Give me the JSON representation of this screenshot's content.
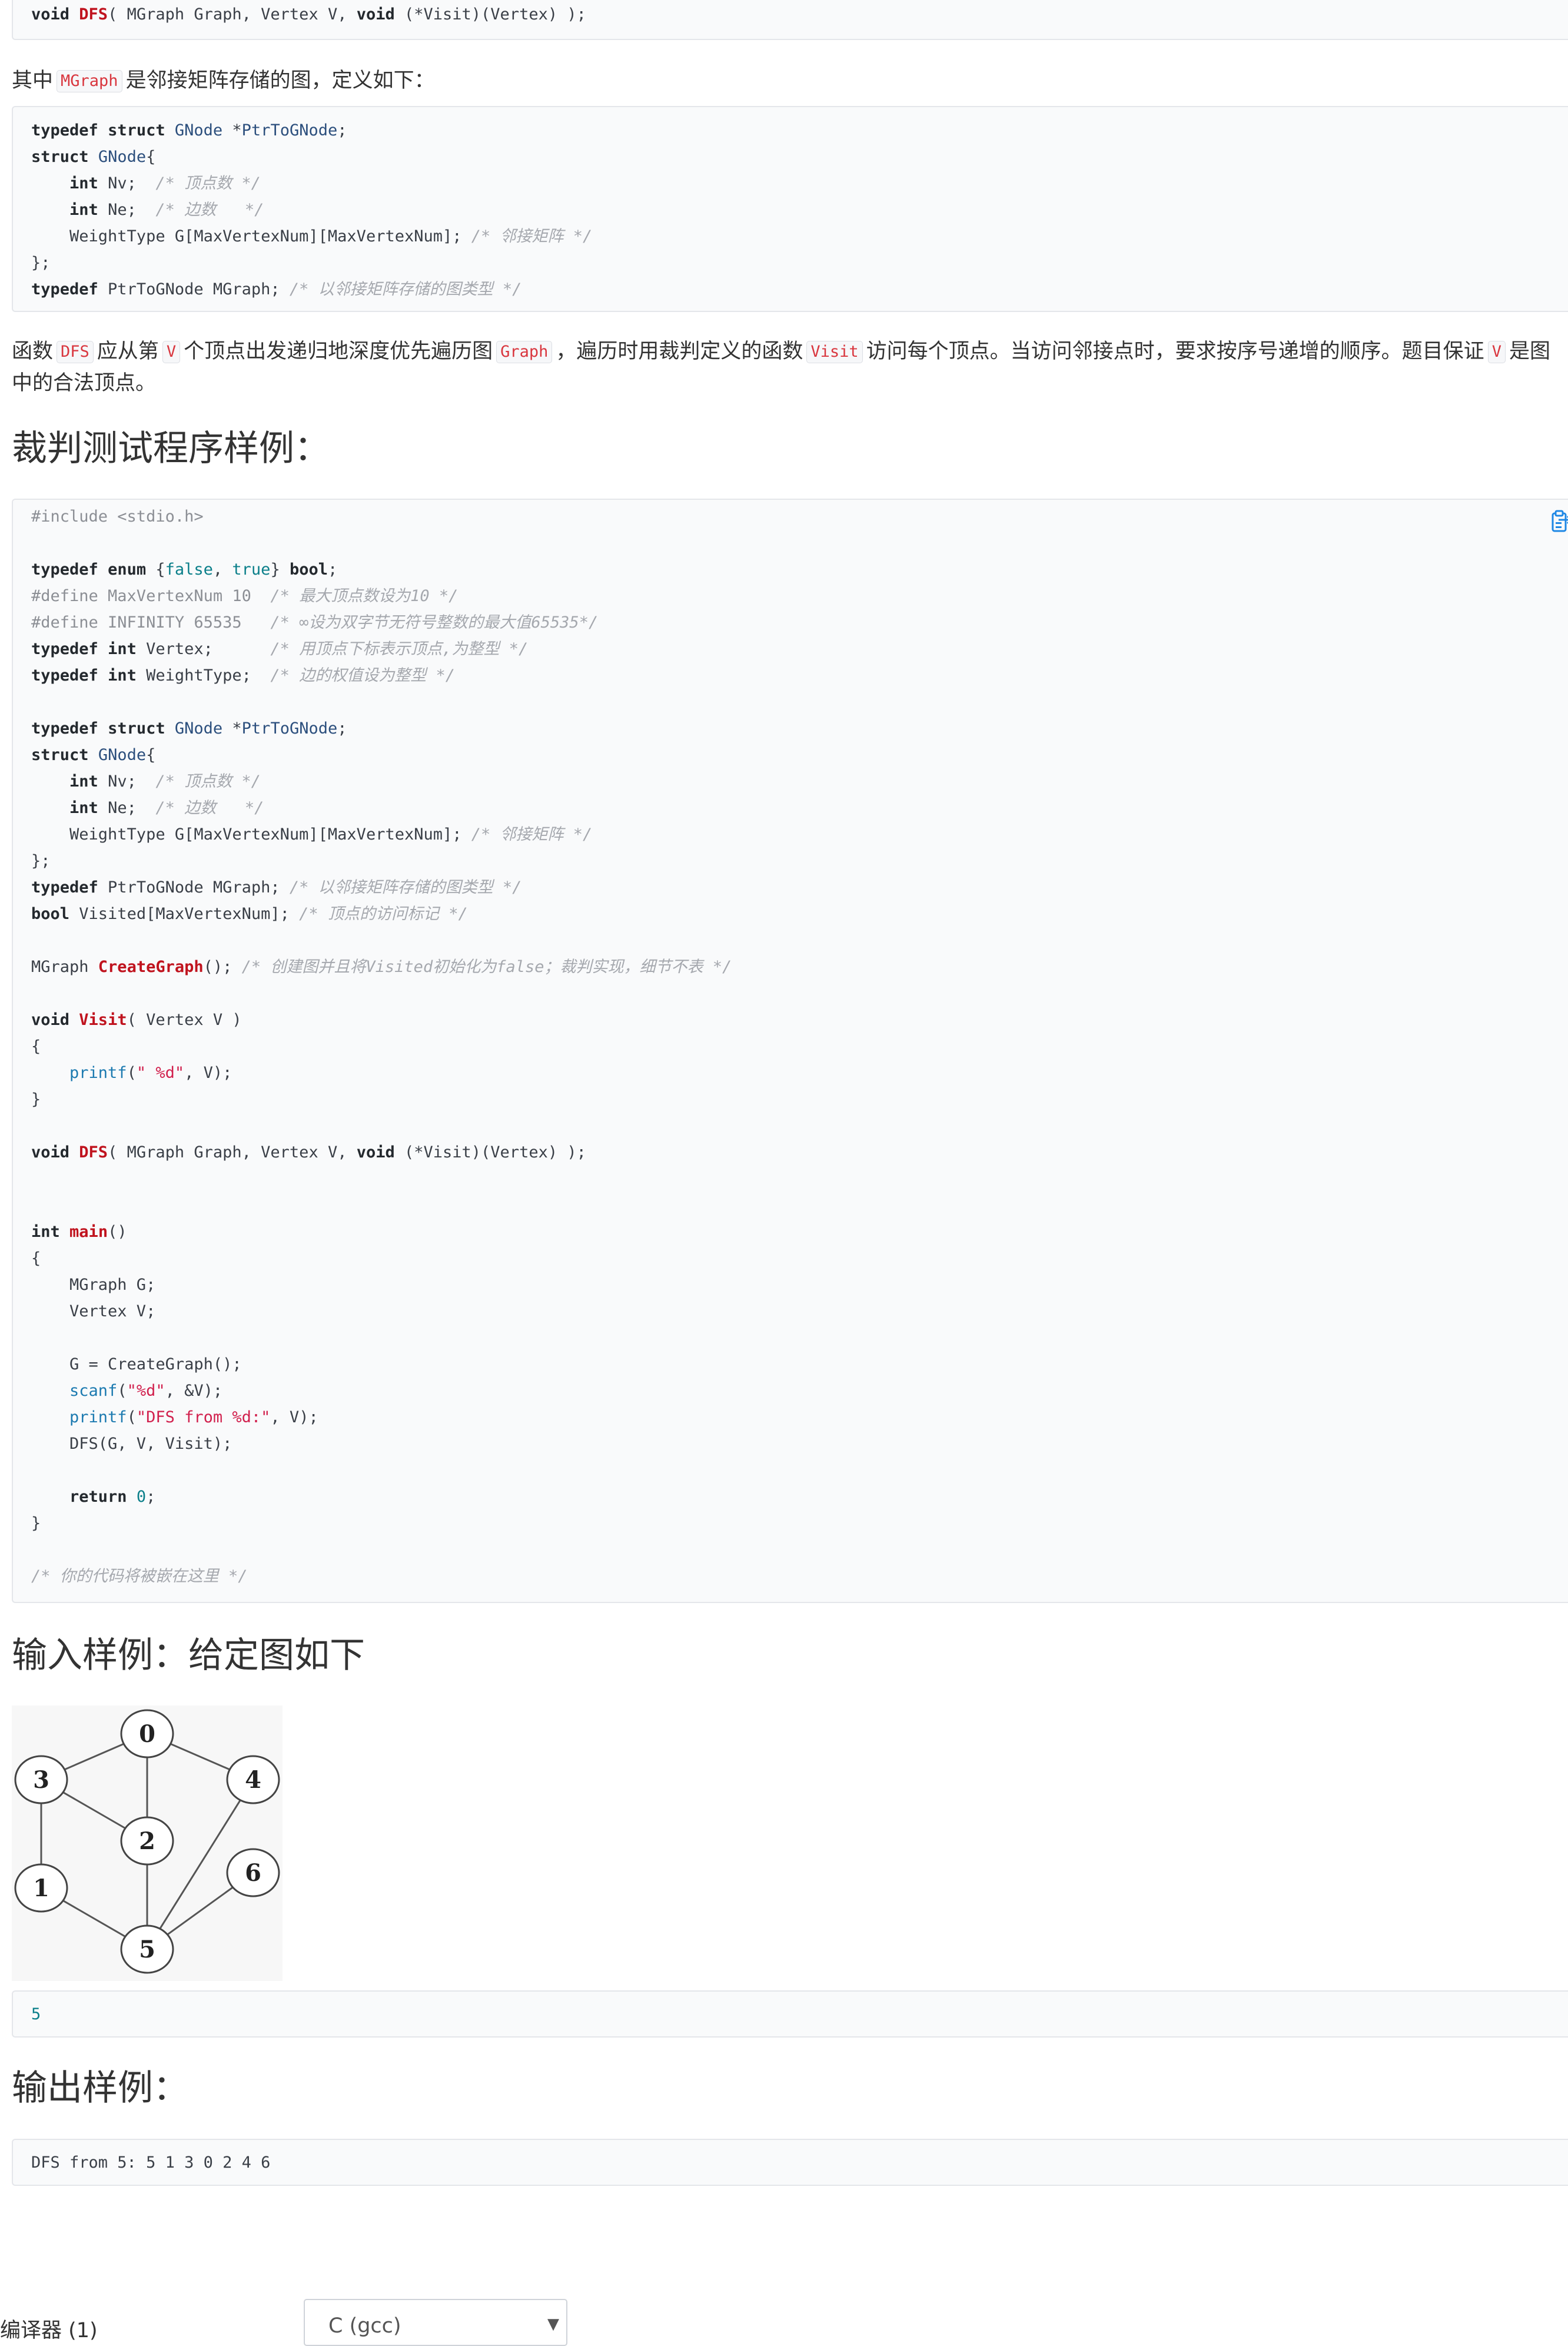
{
  "signature_code": {
    "lines": [
      [
        {
          "t": "void",
          "c": "kw"
        },
        {
          "t": " "
        },
        {
          "t": "DFS",
          "c": "fn"
        },
        {
          "t": "( MGraph Graph, Vertex V, "
        },
        {
          "t": "void",
          "c": "kw"
        },
        {
          "t": " (*Visit)(Vertex) );"
        }
      ]
    ]
  },
  "intro": {
    "before": "其中",
    "code": "MGraph",
    "after": "是邻接矩阵存储的图，定义如下："
  },
  "struct_code": {
    "lines": [
      [
        {
          "t": "typedef",
          "c": "kw"
        },
        {
          "t": " "
        },
        {
          "t": "struct",
          "c": "kw"
        },
        {
          "t": " "
        },
        {
          "t": "GNode",
          "c": "ty"
        },
        {
          "t": " *"
        },
        {
          "t": "PtrToGNode",
          "c": "ty"
        },
        {
          "t": ";"
        }
      ],
      [
        {
          "t": "struct",
          "c": "kw"
        },
        {
          "t": " "
        },
        {
          "t": "GNode",
          "c": "ty"
        },
        {
          "t": "{"
        }
      ],
      [
        {
          "t": "    "
        },
        {
          "t": "int",
          "c": "kw"
        },
        {
          "t": " Nv;  "
        },
        {
          "t": "/* 顶点数 */",
          "c": "cm"
        }
      ],
      [
        {
          "t": "    "
        },
        {
          "t": "int",
          "c": "kw"
        },
        {
          "t": " Ne;  "
        },
        {
          "t": "/* 边数   */",
          "c": "cm"
        }
      ],
      [
        {
          "t": "    WeightType G[MaxVertexNum][MaxVertexNum]; "
        },
        {
          "t": "/* 邻接矩阵 */",
          "c": "cm"
        }
      ],
      [
        {
          "t": "};"
        }
      ],
      [
        {
          "t": "typedef",
          "c": "kw"
        },
        {
          "t": " PtrToGNode MGraph; "
        },
        {
          "t": "/* 以邻接矩阵存储的图类型 */",
          "c": "cm"
        }
      ]
    ]
  },
  "description": {
    "line1": [
      {
        "t": "函数"
      },
      {
        "t": "DFS",
        "code": true
      },
      {
        "t": "应从第"
      },
      {
        "t": "V",
        "code": true
      },
      {
        "t": "个顶点出发递归地深度优先遍历图"
      },
      {
        "t": "Graph",
        "code": true
      },
      {
        "t": "，遍历时用裁判定义的函数"
      },
      {
        "t": "Visit",
        "code": true
      },
      {
        "t": "访问每个顶点。当访问邻接点时，要求按序号递增的顺序。题目保证"
      },
      {
        "t": "V",
        "code": true
      },
      {
        "t": "是图"
      }
    ],
    "line2": [
      {
        "t": "中的合法顶点。"
      }
    ]
  },
  "headings": {
    "judge_sample": "裁判测试程序样例：",
    "input_sample": "输入样例：给定图如下",
    "output_sample": "输出样例："
  },
  "judge_code": {
    "copy_icon": "clipboard-copy-icon",
    "lines": [
      [
        {
          "t": "#include <stdio.h>",
          "c": "pp"
        }
      ],
      [],
      [
        {
          "t": "typedef",
          "c": "kw"
        },
        {
          "t": " "
        },
        {
          "t": "enum",
          "c": "kw"
        },
        {
          "t": " {"
        },
        {
          "t": "false",
          "c": "num"
        },
        {
          "t": ", "
        },
        {
          "t": "true",
          "c": "num"
        },
        {
          "t": "} "
        },
        {
          "t": "bool",
          "c": "kw"
        },
        {
          "t": ";"
        }
      ],
      [
        {
          "t": "#define MaxVertexNum 10  ",
          "c": "pp"
        },
        {
          "t": "/* 最大顶点数设为10 */",
          "c": "cm"
        }
      ],
      [
        {
          "t": "#define INFINITY 65535   ",
          "c": "pp"
        },
        {
          "t": "/* ∞设为双字节无符号整数的最大值65535*/",
          "c": "cm"
        }
      ],
      [
        {
          "t": "typedef",
          "c": "kw"
        },
        {
          "t": " "
        },
        {
          "t": "int",
          "c": "kw"
        },
        {
          "t": " Vertex;      "
        },
        {
          "t": "/* 用顶点下标表示顶点,为整型 */",
          "c": "cm"
        }
      ],
      [
        {
          "t": "typedef",
          "c": "kw"
        },
        {
          "t": " "
        },
        {
          "t": "int",
          "c": "kw"
        },
        {
          "t": " WeightType;  "
        },
        {
          "t": "/* 边的权值设为整型 */",
          "c": "cm"
        }
      ],
      [],
      [
        {
          "t": "typedef",
          "c": "kw"
        },
        {
          "t": " "
        },
        {
          "t": "struct",
          "c": "kw"
        },
        {
          "t": " "
        },
        {
          "t": "GNode",
          "c": "ty"
        },
        {
          "t": " *"
        },
        {
          "t": "PtrToGNode",
          "c": "ty"
        },
        {
          "t": ";"
        }
      ],
      [
        {
          "t": "struct",
          "c": "kw"
        },
        {
          "t": " "
        },
        {
          "t": "GNode",
          "c": "ty"
        },
        {
          "t": "{"
        }
      ],
      [
        {
          "t": "    "
        },
        {
          "t": "int",
          "c": "kw"
        },
        {
          "t": " Nv;  "
        },
        {
          "t": "/* 顶点数 */",
          "c": "cm"
        }
      ],
      [
        {
          "t": "    "
        },
        {
          "t": "int",
          "c": "kw"
        },
        {
          "t": " Ne;  "
        },
        {
          "t": "/* 边数   */",
          "c": "cm"
        }
      ],
      [
        {
          "t": "    WeightType G[MaxVertexNum][MaxVertexNum]; "
        },
        {
          "t": "/* 邻接矩阵 */",
          "c": "cm"
        }
      ],
      [
        {
          "t": "};"
        }
      ],
      [
        {
          "t": "typedef",
          "c": "kw"
        },
        {
          "t": " PtrToGNode MGraph; "
        },
        {
          "t": "/* 以邻接矩阵存储的图类型 */",
          "c": "cm"
        }
      ],
      [
        {
          "t": "bool",
          "c": "kw"
        },
        {
          "t": " Visited[MaxVertexNum]; "
        },
        {
          "t": "/* 顶点的访问标记 */",
          "c": "cm"
        }
      ],
      [],
      [
        {
          "t": "MGraph "
        },
        {
          "t": "CreateGraph",
          "c": "fn"
        },
        {
          "t": "(); "
        },
        {
          "t": "/* 创建图并且将Visited初始化为false；裁判实现，细节不表 */",
          "c": "cm"
        }
      ],
      [],
      [
        {
          "t": "void",
          "c": "kw"
        },
        {
          "t": " "
        },
        {
          "t": "Visit",
          "c": "fn"
        },
        {
          "t": "( Vertex V )"
        }
      ],
      [
        {
          "t": "{"
        }
      ],
      [
        {
          "t": "    "
        },
        {
          "t": "printf",
          "c": "bi"
        },
        {
          "t": "("
        },
        {
          "t": "\" %d\"",
          "c": "str"
        },
        {
          "t": ", V);"
        }
      ],
      [
        {
          "t": "}"
        }
      ],
      [],
      [
        {
          "t": "void",
          "c": "kw"
        },
        {
          "t": " "
        },
        {
          "t": "DFS",
          "c": "fn"
        },
        {
          "t": "( MGraph Graph, Vertex V, "
        },
        {
          "t": "void",
          "c": "kw"
        },
        {
          "t": " (*Visit)(Vertex) );"
        }
      ],
      [],
      [],
      [
        {
          "t": "int",
          "c": "kw"
        },
        {
          "t": " "
        },
        {
          "t": "main",
          "c": "fn"
        },
        {
          "t": "()"
        }
      ],
      [
        {
          "t": "{"
        }
      ],
      [
        {
          "t": "    MGraph G;"
        }
      ],
      [
        {
          "t": "    Vertex V;"
        }
      ],
      [],
      [
        {
          "t": "    G = CreateGraph();"
        }
      ],
      [
        {
          "t": "    "
        },
        {
          "t": "scanf",
          "c": "bi"
        },
        {
          "t": "("
        },
        {
          "t": "\"%d\"",
          "c": "str"
        },
        {
          "t": ", &V);"
        }
      ],
      [
        {
          "t": "    "
        },
        {
          "t": "printf",
          "c": "bi"
        },
        {
          "t": "("
        },
        {
          "t": "\"DFS from %d:\"",
          "c": "str"
        },
        {
          "t": ", V);"
        }
      ],
      [
        {
          "t": "    DFS(G, V, Visit);"
        }
      ],
      [],
      [
        {
          "t": "    "
        },
        {
          "t": "return",
          "c": "kw"
        },
        {
          "t": " "
        },
        {
          "t": "0",
          "c": "num"
        },
        {
          "t": ";"
        }
      ],
      [
        {
          "t": "}"
        }
      ],
      [],
      [
        {
          "t": "/* 你的代码将被嵌在这里 */",
          "c": "cm"
        }
      ]
    ]
  },
  "graph": {
    "nodes": [
      "0",
      "1",
      "2",
      "3",
      "4",
      "5",
      "6"
    ],
    "edges": [
      [
        "0",
        "3"
      ],
      [
        "0",
        "4"
      ],
      [
        "0",
        "2"
      ],
      [
        "3",
        "2"
      ],
      [
        "3",
        "1"
      ],
      [
        "1",
        "5"
      ],
      [
        "2",
        "5"
      ],
      [
        "4",
        "5"
      ],
      [
        "6",
        "5"
      ]
    ]
  },
  "input_sample_code": {
    "lines": [
      [
        {
          "t": "5",
          "c": "num"
        }
      ]
    ]
  },
  "output_sample_code": {
    "lines": [
      [
        {
          "t": "DFS from 5: 5 1 3 0 2 4 6"
        }
      ]
    ]
  },
  "compiler": {
    "label": "编译器 (1)",
    "selected": "C (gcc)"
  }
}
